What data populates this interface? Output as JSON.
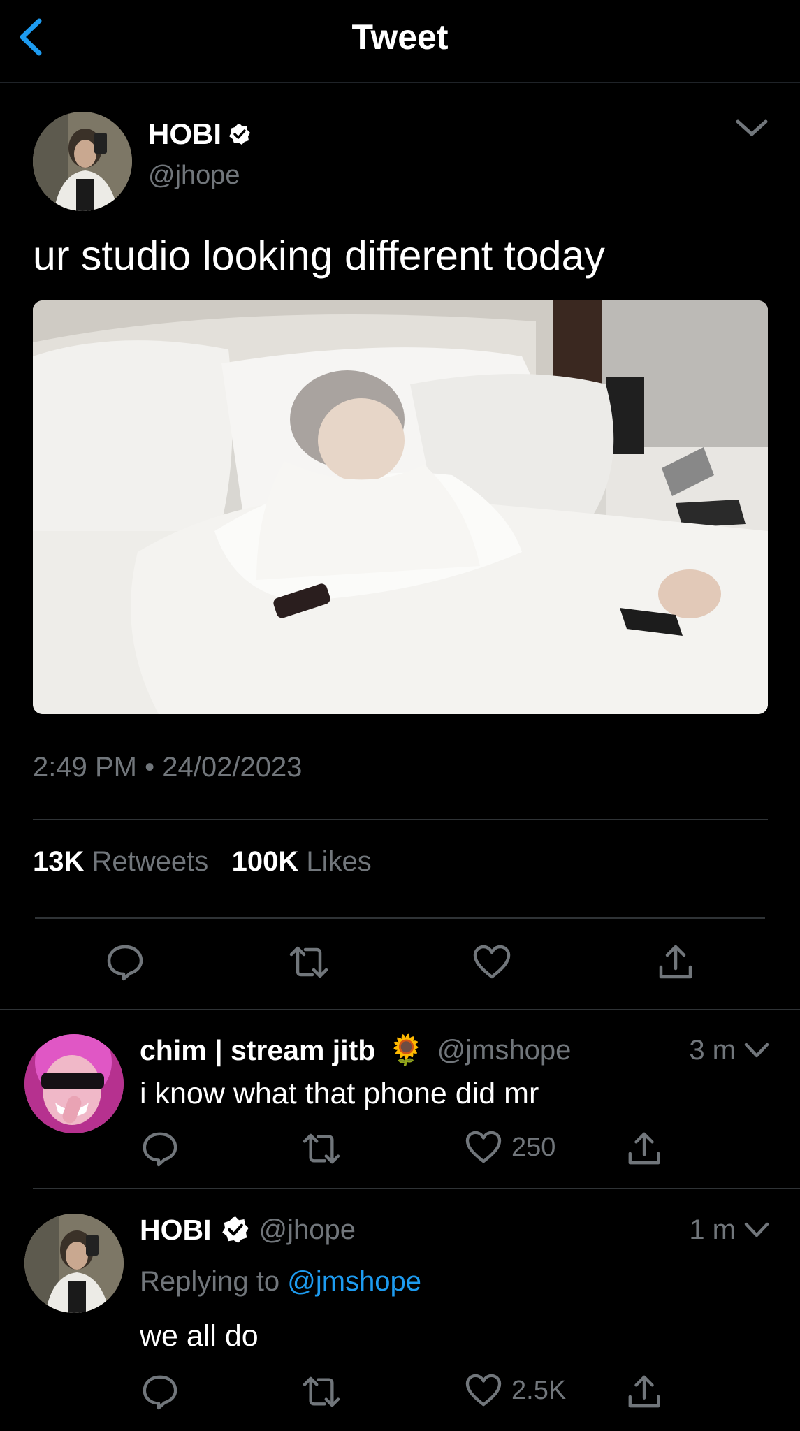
{
  "header": {
    "title": "Tweet"
  },
  "tweet": {
    "display_name": "HOBI",
    "handle": "@jhope",
    "text": "ur studio looking different today",
    "time": "2:49 PM",
    "separator": "•",
    "date": "24/02/2023",
    "retweets_count": "13K",
    "retweets_label": "Retweets",
    "likes_count": "100K",
    "likes_label": "Likes"
  },
  "replies": [
    {
      "display_name": "chim | stream jitb",
      "emoji": "🌻",
      "handle": "@jmshope",
      "time": "3 m",
      "text": "i know what that phone did mr",
      "likes": "250"
    },
    {
      "display_name": "HOBI",
      "handle": "@jhope",
      "time": "1 m",
      "replying_prefix": "Replying to",
      "replying_handle": "@jmshope",
      "text": "we all do",
      "likes": "2.5K"
    }
  ],
  "colors": {
    "background": "#000000",
    "secondary_text": "#71767b",
    "link_blue": "#1d9bf0",
    "divider": "#2f3336"
  },
  "icons": [
    "back-chevron-icon",
    "verified-badge-icon",
    "chevron-down-icon",
    "reply-icon",
    "retweet-icon",
    "like-icon",
    "share-icon"
  ]
}
